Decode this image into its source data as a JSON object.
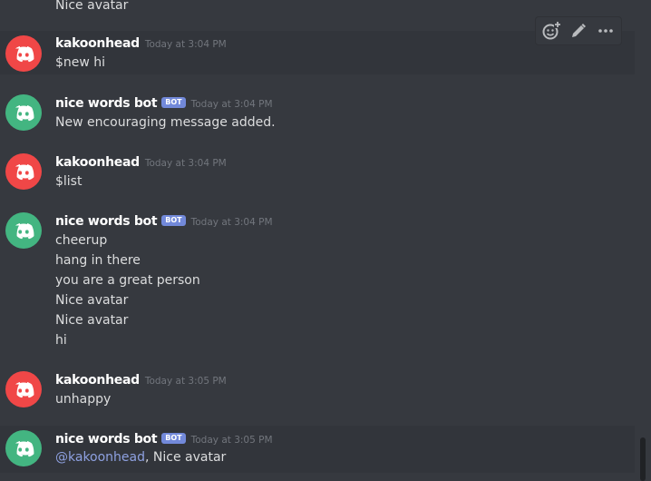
{
  "colors": {
    "background": "#36393f",
    "hover_background": "#32353b",
    "human_avatar": "#f04747",
    "bot_avatar": "#43b581",
    "bot_tag": "#7289da",
    "mention": "#8ea1e1"
  },
  "top_partial_line": "Nice avatar",
  "messages": [
    {
      "username": "kakoonhead",
      "timestamp": "Today at 3:04 PM",
      "avatar_icon": "discord-logo-red",
      "lines": [
        "$new hi"
      ]
    },
    {
      "username": "nice words bot",
      "bot_tag": "BOT",
      "timestamp": "Today at 3:04 PM",
      "avatar_icon": "discord-logo-green",
      "lines": [
        "New encouraging message added."
      ]
    },
    {
      "username": "kakoonhead",
      "timestamp": "Today at 3:04 PM",
      "avatar_icon": "discord-logo-red",
      "lines": [
        "$list"
      ]
    },
    {
      "username": "nice words bot",
      "bot_tag": "BOT",
      "timestamp": "Today at 3:04 PM",
      "avatar_icon": "discord-logo-green",
      "lines": [
        "cheerup",
        "hang in there",
        "you are a great person",
        "Nice avatar",
        "Nice avatar",
        "hi"
      ]
    },
    {
      "username": "kakoonhead",
      "timestamp": "Today at 3:05 PM",
      "avatar_icon": "discord-logo-red",
      "lines": [
        "unhappy"
      ]
    },
    {
      "username": "nice words bot",
      "bot_tag": "BOT",
      "timestamp": "Today at 3:05 PM",
      "avatar_icon": "discord-logo-green",
      "mention": "@kakoonhead",
      "reply_text": ", Nice avatar"
    }
  ],
  "toolbar": {
    "icons": [
      "add-reaction-icon",
      "edit-pencil-icon",
      "more-options-icon"
    ]
  }
}
